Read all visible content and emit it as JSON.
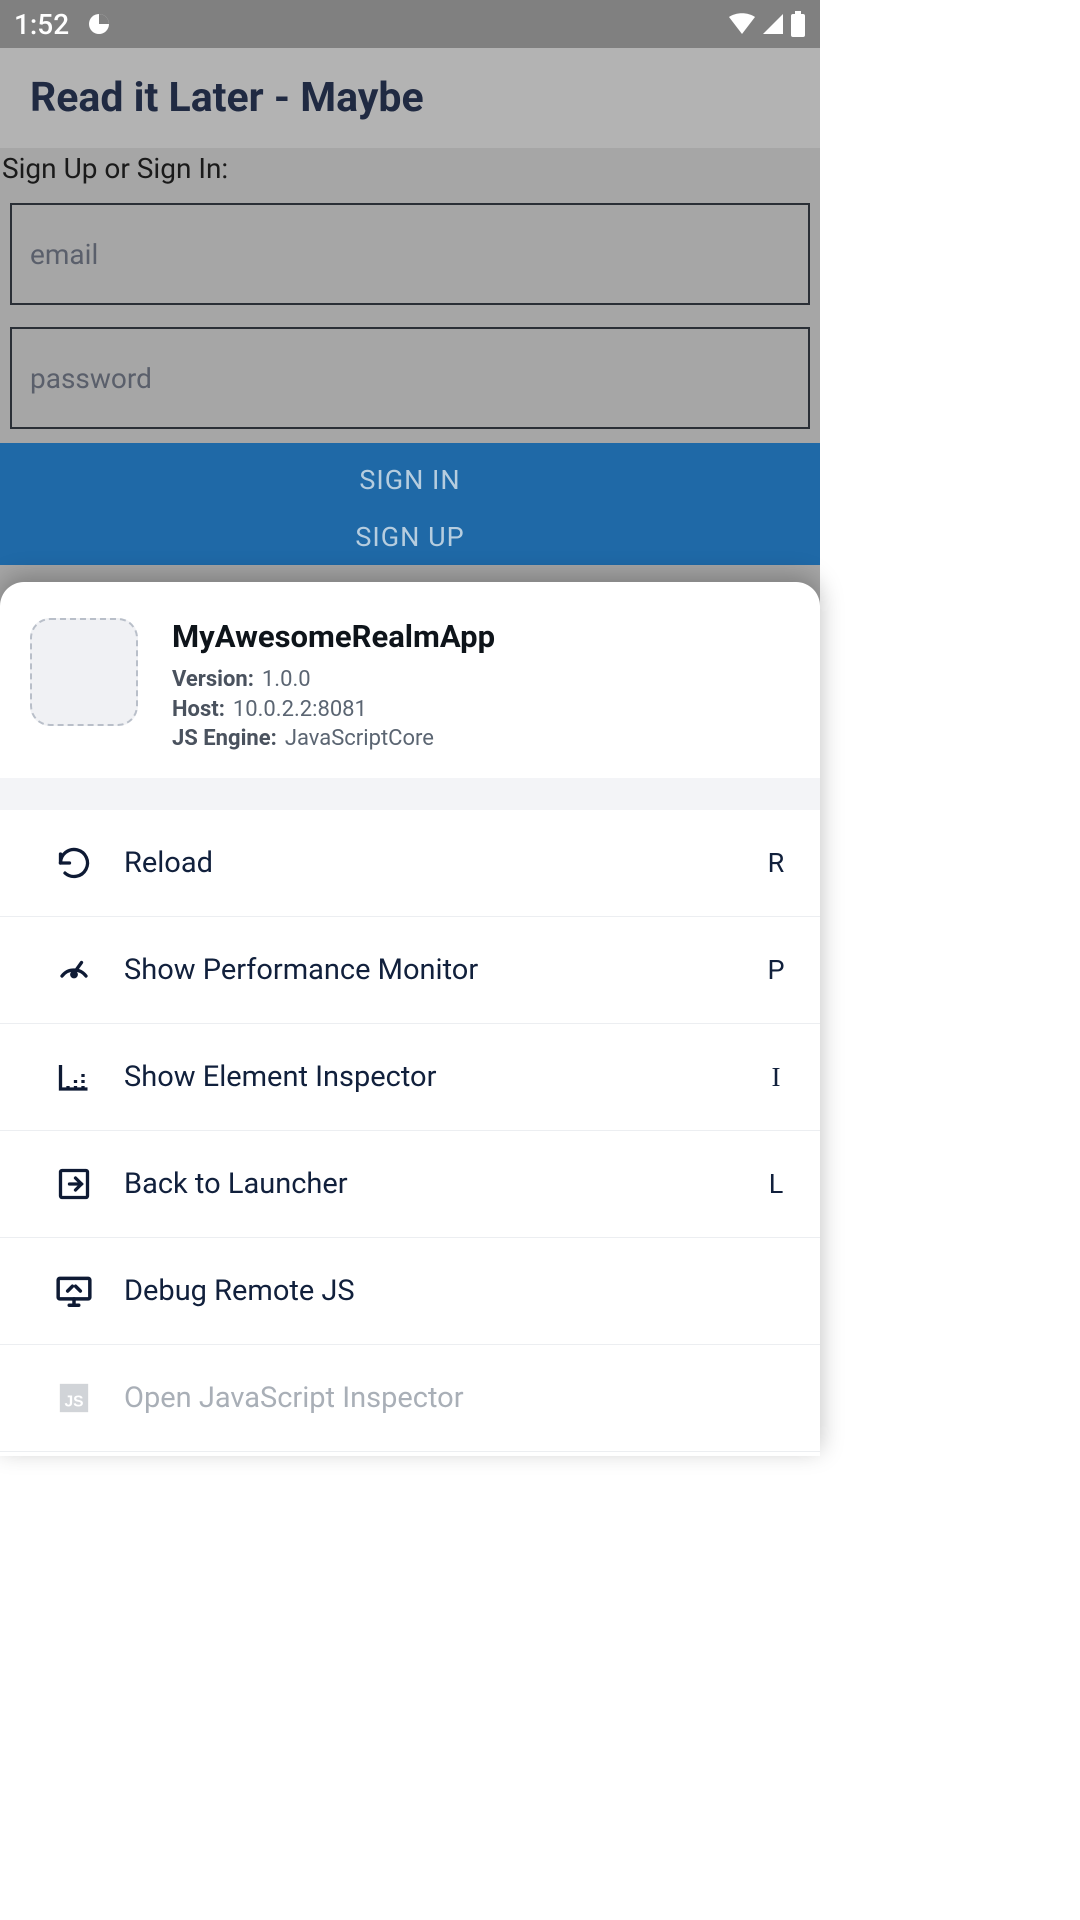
{
  "statusBar": {
    "time": "1:52"
  },
  "app": {
    "title": "Read it Later - Maybe",
    "signLabel": "Sign Up or Sign In:",
    "emailPlaceholder": "email",
    "passwordPlaceholder": "password",
    "signInLabel": "SIGN IN",
    "signUpLabel": "SIGN UP"
  },
  "devSheet": {
    "appName": "MyAwesomeRealmApp",
    "versionKey": "Version:",
    "versionVal": "1.0.0",
    "hostKey": "Host:",
    "hostVal": "10.0.2.2:8081",
    "engineKey": "JS Engine:",
    "engineVal": "JavaScriptCore",
    "items": [
      {
        "label": "Reload",
        "shortcut": "R"
      },
      {
        "label": "Show Performance Monitor",
        "shortcut": "P"
      },
      {
        "label": "Show Element Inspector",
        "shortcut": "I"
      },
      {
        "label": "Back to Launcher",
        "shortcut": "L"
      },
      {
        "label": "Debug Remote JS",
        "shortcut": ""
      },
      {
        "label": "Open JavaScript Inspector",
        "shortcut": ""
      }
    ]
  }
}
